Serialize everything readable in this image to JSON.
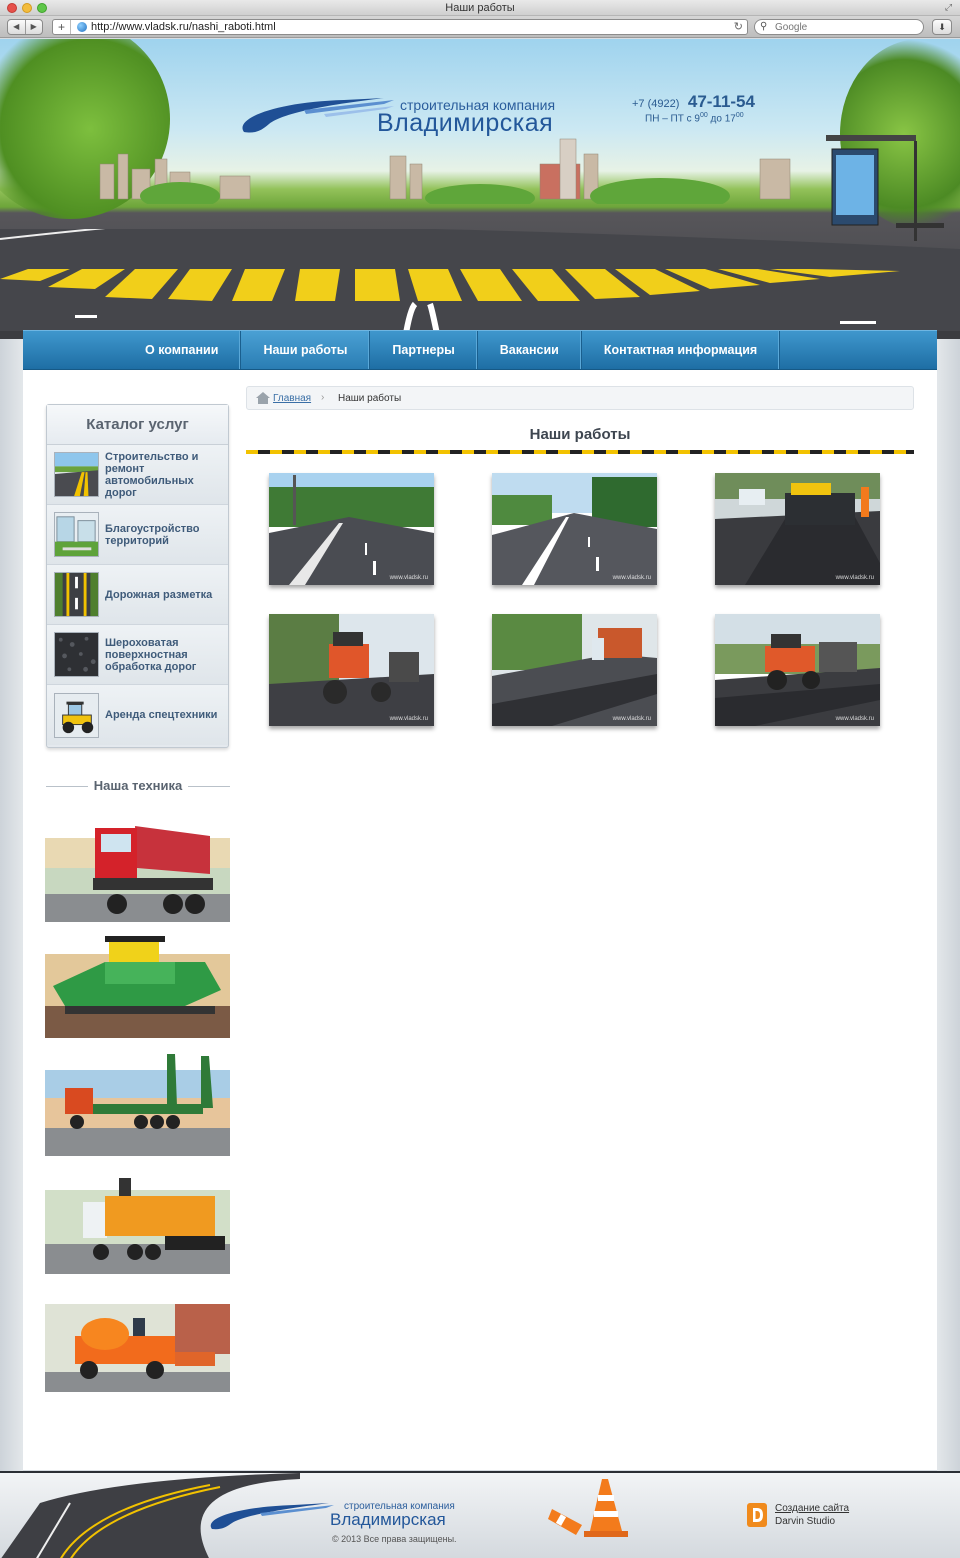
{
  "browser": {
    "window_title": "Наши работы",
    "url": "http://www.vladsk.ru/nashi_raboti.html",
    "search_placeholder": "Google"
  },
  "header": {
    "logo_subtitle": "строительная компания",
    "logo_title": "Владимирская",
    "phone_code": "+7 (4922)",
    "phone_number": "47-11-54",
    "hours_prefix": "ПН – ПТ с 9",
    "hours_start_sup": "00",
    "hours_mid": " до 17",
    "hours_end_sup": "00"
  },
  "nav": {
    "items": [
      {
        "label": "О компании"
      },
      {
        "label": "Наши работы"
      },
      {
        "label": "Партнеры"
      },
      {
        "label": "Вакансии"
      },
      {
        "label": "Контактная информация"
      }
    ]
  },
  "sidebar": {
    "catalog_title": "Каталог услуг",
    "catalog_items": [
      {
        "label": "Строительство и ремонт автомобильных дорог",
        "icon": "road-thumb"
      },
      {
        "label": "Благоустройство территорий",
        "icon": "landscaping-thumb"
      },
      {
        "label": "Дорожная разметка",
        "icon": "road-marking-thumb"
      },
      {
        "label": "Шероховатая поверхностная обработка дорог",
        "icon": "asphalt-texture-thumb"
      },
      {
        "label": "Аренда спецтехники",
        "icon": "roller-thumb"
      }
    ],
    "tech_title": "Наша техника"
  },
  "breadcrumb": {
    "home_label": "Главная",
    "current_label": "Наши работы"
  },
  "main": {
    "title": "Наши работы",
    "watermark": "www.vladsk.ru"
  },
  "footer": {
    "logo_subtitle": "строительная компания",
    "logo_title": "Владимирская",
    "copyright": "© 2013 Все права защищены.",
    "credit_link": "Создание сайта",
    "credit_name": "Darvin Studio"
  },
  "colors": {
    "nav_blue": "#2a7db3",
    "brand_blue": "#23579a",
    "hazard_yellow": "#f2c200"
  }
}
